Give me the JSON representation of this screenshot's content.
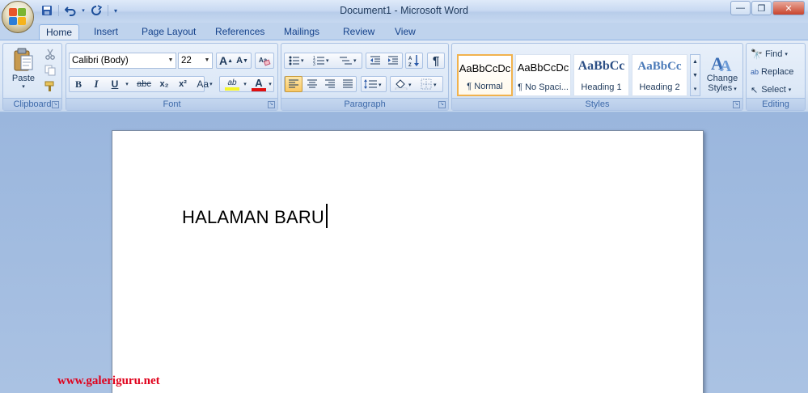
{
  "window": {
    "title": "Document1 - Microsoft Word",
    "controls": [
      "—",
      "❐",
      "✕"
    ]
  },
  "quick_access": {
    "save_icon": "save-icon",
    "undo_icon": "undo-icon",
    "redo_icon": "redo-icon"
  },
  "tabs": [
    {
      "label": "Home",
      "active": true
    },
    {
      "label": "Insert"
    },
    {
      "label": "Page Layout"
    },
    {
      "label": "References"
    },
    {
      "label": "Mailings"
    },
    {
      "label": "Review"
    },
    {
      "label": "View"
    }
  ],
  "clipboard": {
    "paste_label": "Paste",
    "group_label": "Clipboard"
  },
  "font": {
    "family": "Calibri (Body)",
    "size": "22",
    "group_label": "Font",
    "bold": "B",
    "italic": "I",
    "underline": "U",
    "strike": "abc",
    "subscript": "x₂",
    "superscript": "x²",
    "change_case": "Aa",
    "highlight": "ab",
    "font_color": "A",
    "grow": "A",
    "shrink": "A",
    "highlight_color": "#f5f52a",
    "font_color_value": "#e01010"
  },
  "paragraph": {
    "group_label": "Paragraph",
    "show_marks": "¶"
  },
  "styles": {
    "group_label": "Styles",
    "items": [
      {
        "sample": "AaBbCcDc",
        "name": "¶ Normal",
        "selected": true
      },
      {
        "sample": "AaBbCcDc",
        "name": "¶ No Spaci..."
      },
      {
        "sample": "AaBbCc",
        "name": "Heading 1"
      },
      {
        "sample": "AaBbCc",
        "name": "Heading 2"
      }
    ],
    "change_styles_line1": "Change",
    "change_styles_line2": "Styles"
  },
  "editing": {
    "group_label": "Editing",
    "find": "Find",
    "replace": "Replace",
    "select": "Select"
  },
  "document": {
    "text": "HALAMAN BARU"
  },
  "watermark": "www.galeriguru.net"
}
